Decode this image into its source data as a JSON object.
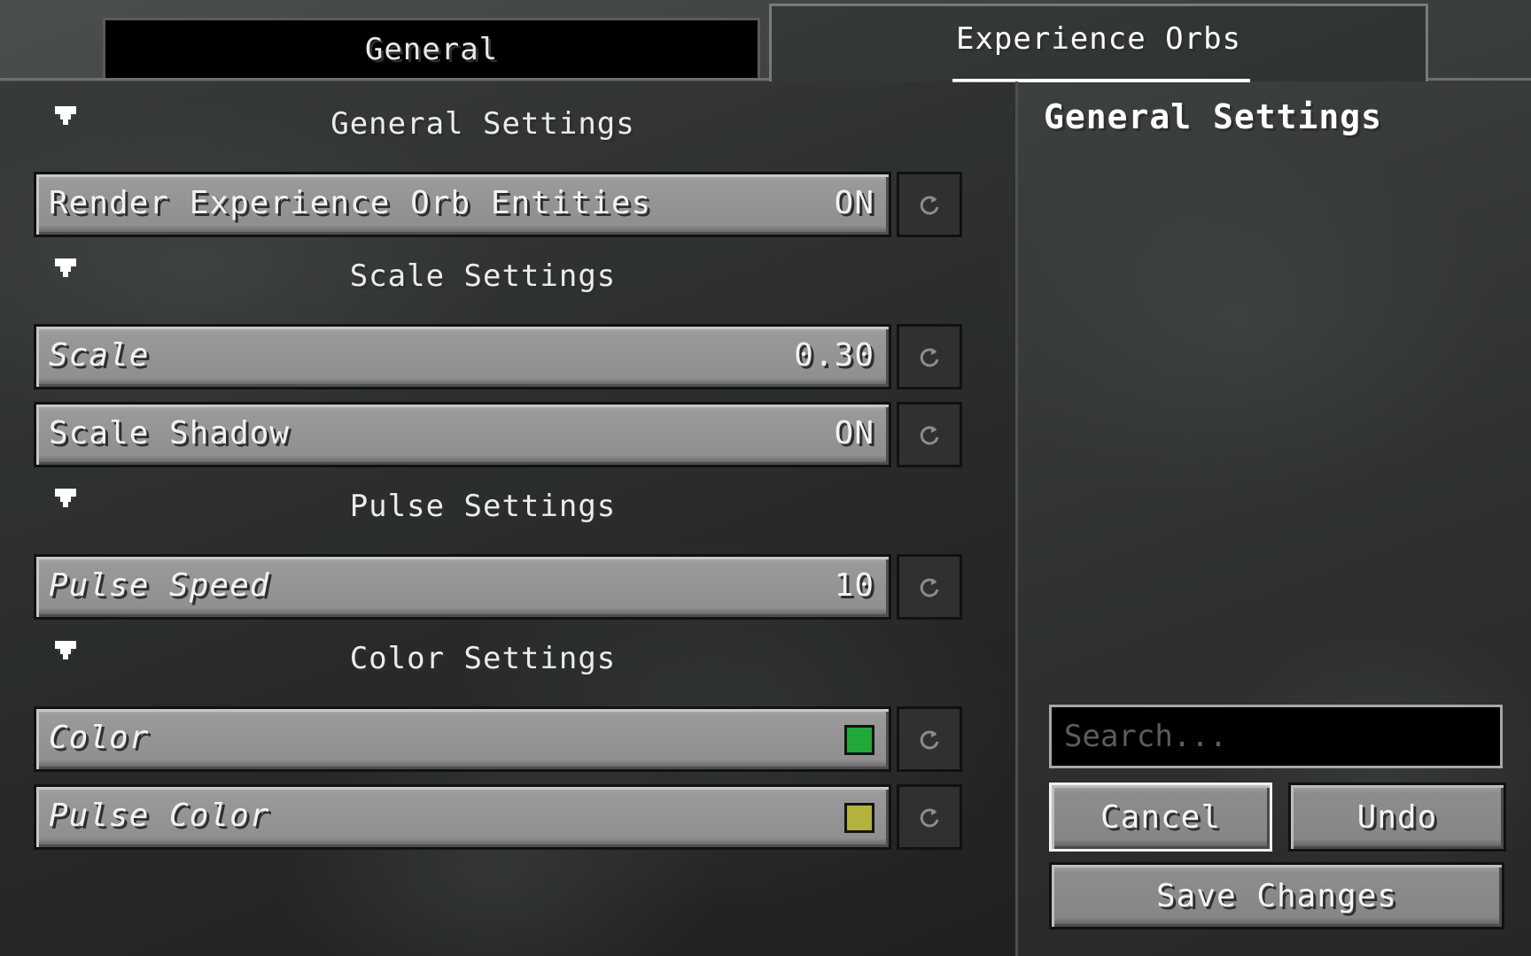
{
  "tabs": [
    {
      "label": "General",
      "active": false
    },
    {
      "label": "Experience Orbs",
      "active": true
    }
  ],
  "sections": {
    "general": {
      "title": "General Settings",
      "entries": [
        {
          "label": "Render Experience Orb Entities",
          "value": "ON"
        }
      ]
    },
    "scale": {
      "title": "Scale Settings",
      "entries": [
        {
          "label": "Scale",
          "value": "0.30"
        },
        {
          "label": "Scale Shadow",
          "value": "ON"
        }
      ]
    },
    "pulse": {
      "title": "Pulse Settings",
      "entries": [
        {
          "label": "Pulse Speed",
          "value": "10"
        }
      ]
    },
    "color": {
      "title": "Color Settings",
      "entries": [
        {
          "label": "Color",
          "swatch": "#22a93a"
        },
        {
          "label": "Pulse Color",
          "swatch": "#b3b23a"
        }
      ]
    }
  },
  "detail": {
    "title": "General Settings"
  },
  "search": {
    "placeholder": "Search..."
  },
  "buttons": {
    "cancel": "Cancel",
    "undo": "Undo",
    "save": "Save Changes"
  },
  "icons": {
    "collapse": "collapse-arrow-icon",
    "reset": "reset-icon"
  },
  "colors": {
    "active_tab_underline": "#ffffff",
    "button_face": "#8f8f8f",
    "reset_button_face": "#303030"
  }
}
